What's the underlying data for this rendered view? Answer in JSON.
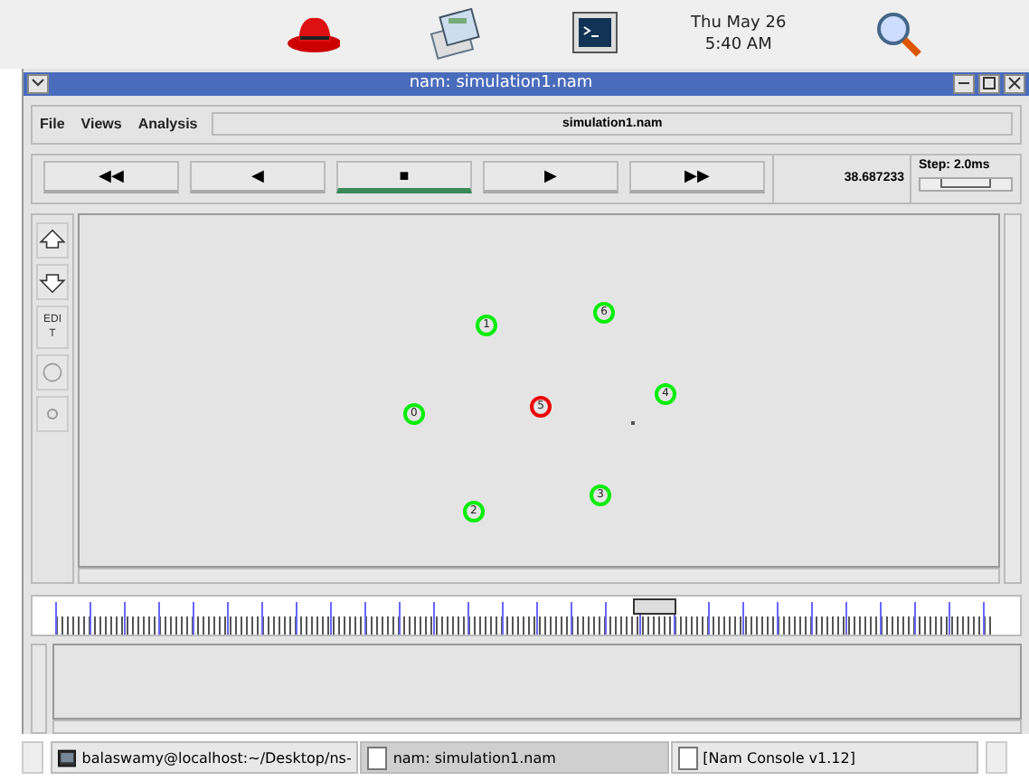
{
  "top_panel": {
    "launchers": [
      {
        "kind": "hat"
      },
      {
        "kind": "office"
      },
      {
        "kind": "terminal"
      }
    ],
    "clock": {
      "day": "Thu May 26",
      "time": "5:40 AM"
    }
  },
  "window": {
    "title": "nam: simulation1.nam"
  },
  "menu": [
    {
      "label": "File"
    },
    {
      "label": "Views"
    },
    {
      "label": "Analysis"
    }
  ],
  "file_label": "simulation1.nam",
  "playback": [
    {
      "symbol": "◀◀",
      "selected": false
    },
    {
      "symbol": "◀",
      "selected": false
    },
    {
      "symbol": "■",
      "selected": true
    },
    {
      "symbol": "▶",
      "selected": false
    },
    {
      "symbol": "▶▶",
      "selected": false
    }
  ],
  "time_reading": "38.687233",
  "step": {
    "label": "Step: 2.0ms",
    "level": 0.5
  },
  "tools": [
    {
      "kind": "zoom-in"
    },
    {
      "kind": "zoom-out"
    },
    {
      "kind": "text",
      "label": "EDIT"
    },
    {
      "kind": "circle"
    },
    {
      "kind": "dot"
    }
  ],
  "nodes": [
    {
      "label": "0",
      "color": "#00ee00"
    },
    {
      "label": "1",
      "color": "#00ee00"
    },
    {
      "label": "2",
      "color": "#00ee00"
    },
    {
      "label": "3",
      "color": "#00ee00"
    },
    {
      "label": "4",
      "color": "#00ee00"
    },
    {
      "label": "5",
      "color": "#ee0000"
    },
    {
      "label": "6",
      "color": "#00ee00"
    }
  ],
  "timeline": {
    "level": 0.63
  },
  "taskbar": [
    {
      "kind": "terminal",
      "label": "balaswamy@localhost:~/Desktop/ns-",
      "selected": false
    },
    {
      "kind": "window",
      "label": "nam: simulation1.nam",
      "selected": true
    },
    {
      "kind": "window",
      "label": "[Nam Console v1.12]",
      "selected": false
    }
  ]
}
